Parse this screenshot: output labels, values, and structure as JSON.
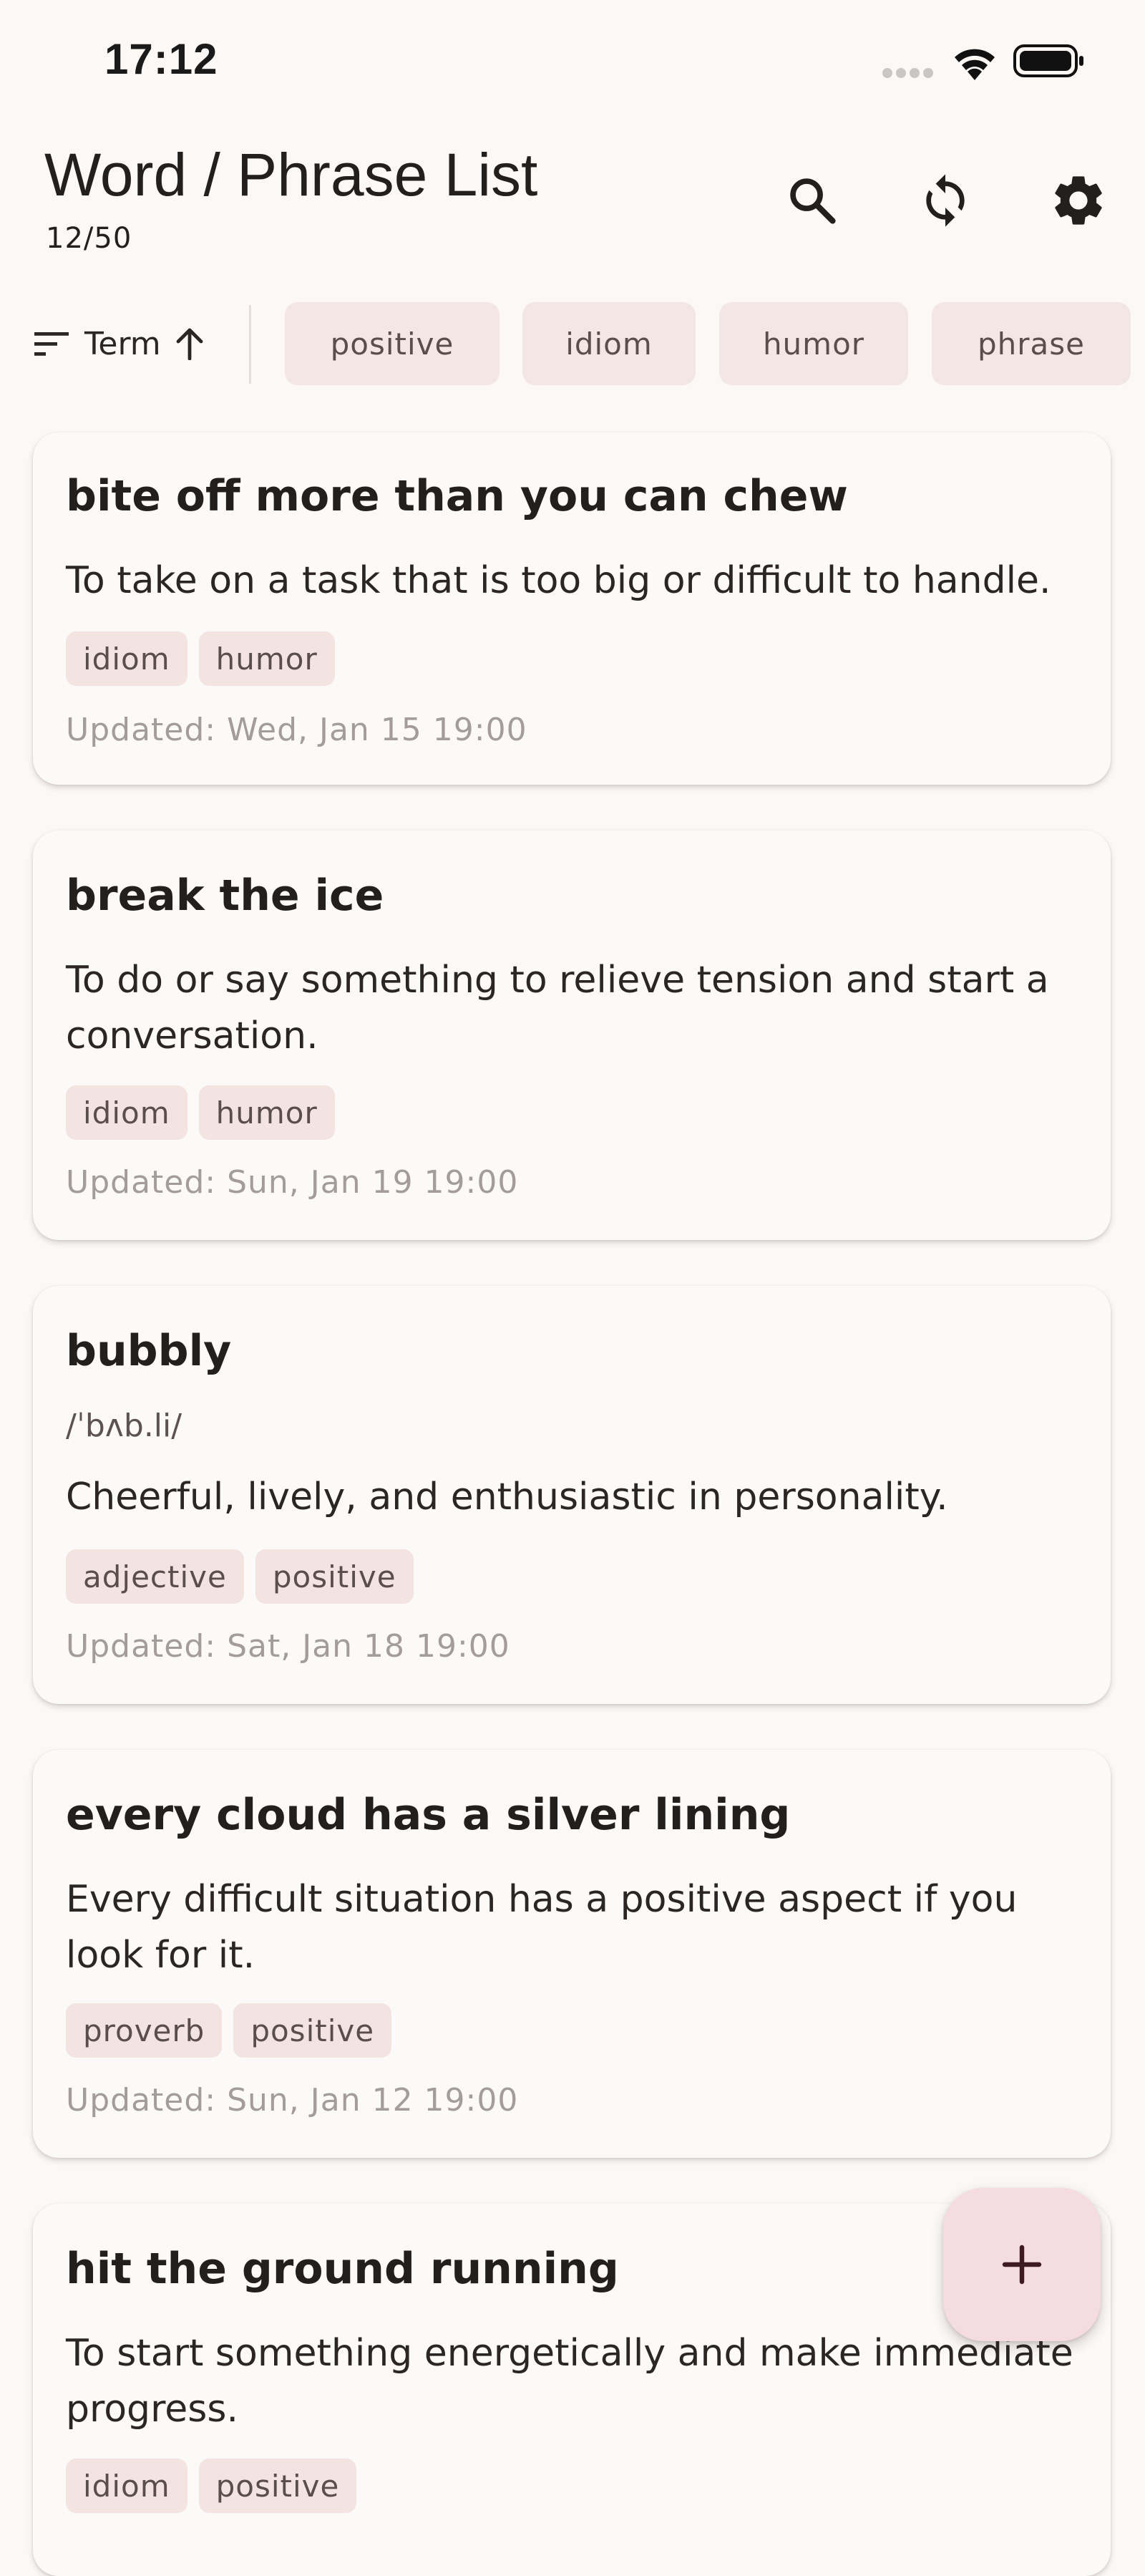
{
  "status_bar": {
    "time": "17:12",
    "icons": [
      "signal-icon",
      "wifi-icon",
      "battery-icon"
    ]
  },
  "header": {
    "title": "Word / Phrase List",
    "count": "12/50",
    "actions": [
      "search-icon",
      "sync-icon",
      "settings-icon"
    ]
  },
  "filter_bar": {
    "sort_label": "Term",
    "sort_direction_icon": "arrow-up-icon",
    "tags": [
      "positive",
      "idiom",
      "humor",
      "phrase"
    ]
  },
  "cards": [
    {
      "term": "bite off more than you can chew",
      "pronunciation": "",
      "definition": "To take on a task that is too big or difficult to handle.",
      "tags": [
        "idiom",
        "humor"
      ],
      "updated": "Updated: Wed, Jan 15 19:00"
    },
    {
      "term": "break the ice",
      "pronunciation": "",
      "definition": "To do or say something to relieve tension and start a conversation.",
      "tags": [
        "idiom",
        "humor"
      ],
      "updated": "Updated: Sun, Jan 19 19:00"
    },
    {
      "term": "bubbly",
      "pronunciation": "/ˈbʌb.li/",
      "definition": "Cheerful, lively, and enthusiastic in personality.",
      "tags": [
        "adjective",
        "positive"
      ],
      "updated": "Updated: Sat, Jan 18 19:00"
    },
    {
      "term": "every cloud has a silver lining",
      "pronunciation": "",
      "definition": "Every difficult situation has a positive aspect if you look for it.",
      "tags": [
        "proverb",
        "positive"
      ],
      "updated": "Updated: Sun, Jan 12 19:00"
    },
    {
      "term": "hit the ground running",
      "pronunciation": "",
      "definition": "To start something energetically and make immediate progress.",
      "tags": [
        "idiom",
        "positive"
      ],
      "updated": ""
    }
  ],
  "fab": {
    "icon": "plus-icon"
  },
  "colors": {
    "background": "#FBF8F6",
    "card": "#FCFAF9",
    "chip": "#F3E4E2",
    "fab": "#F4DCE0",
    "fab_icon": "#3E1A22"
  }
}
